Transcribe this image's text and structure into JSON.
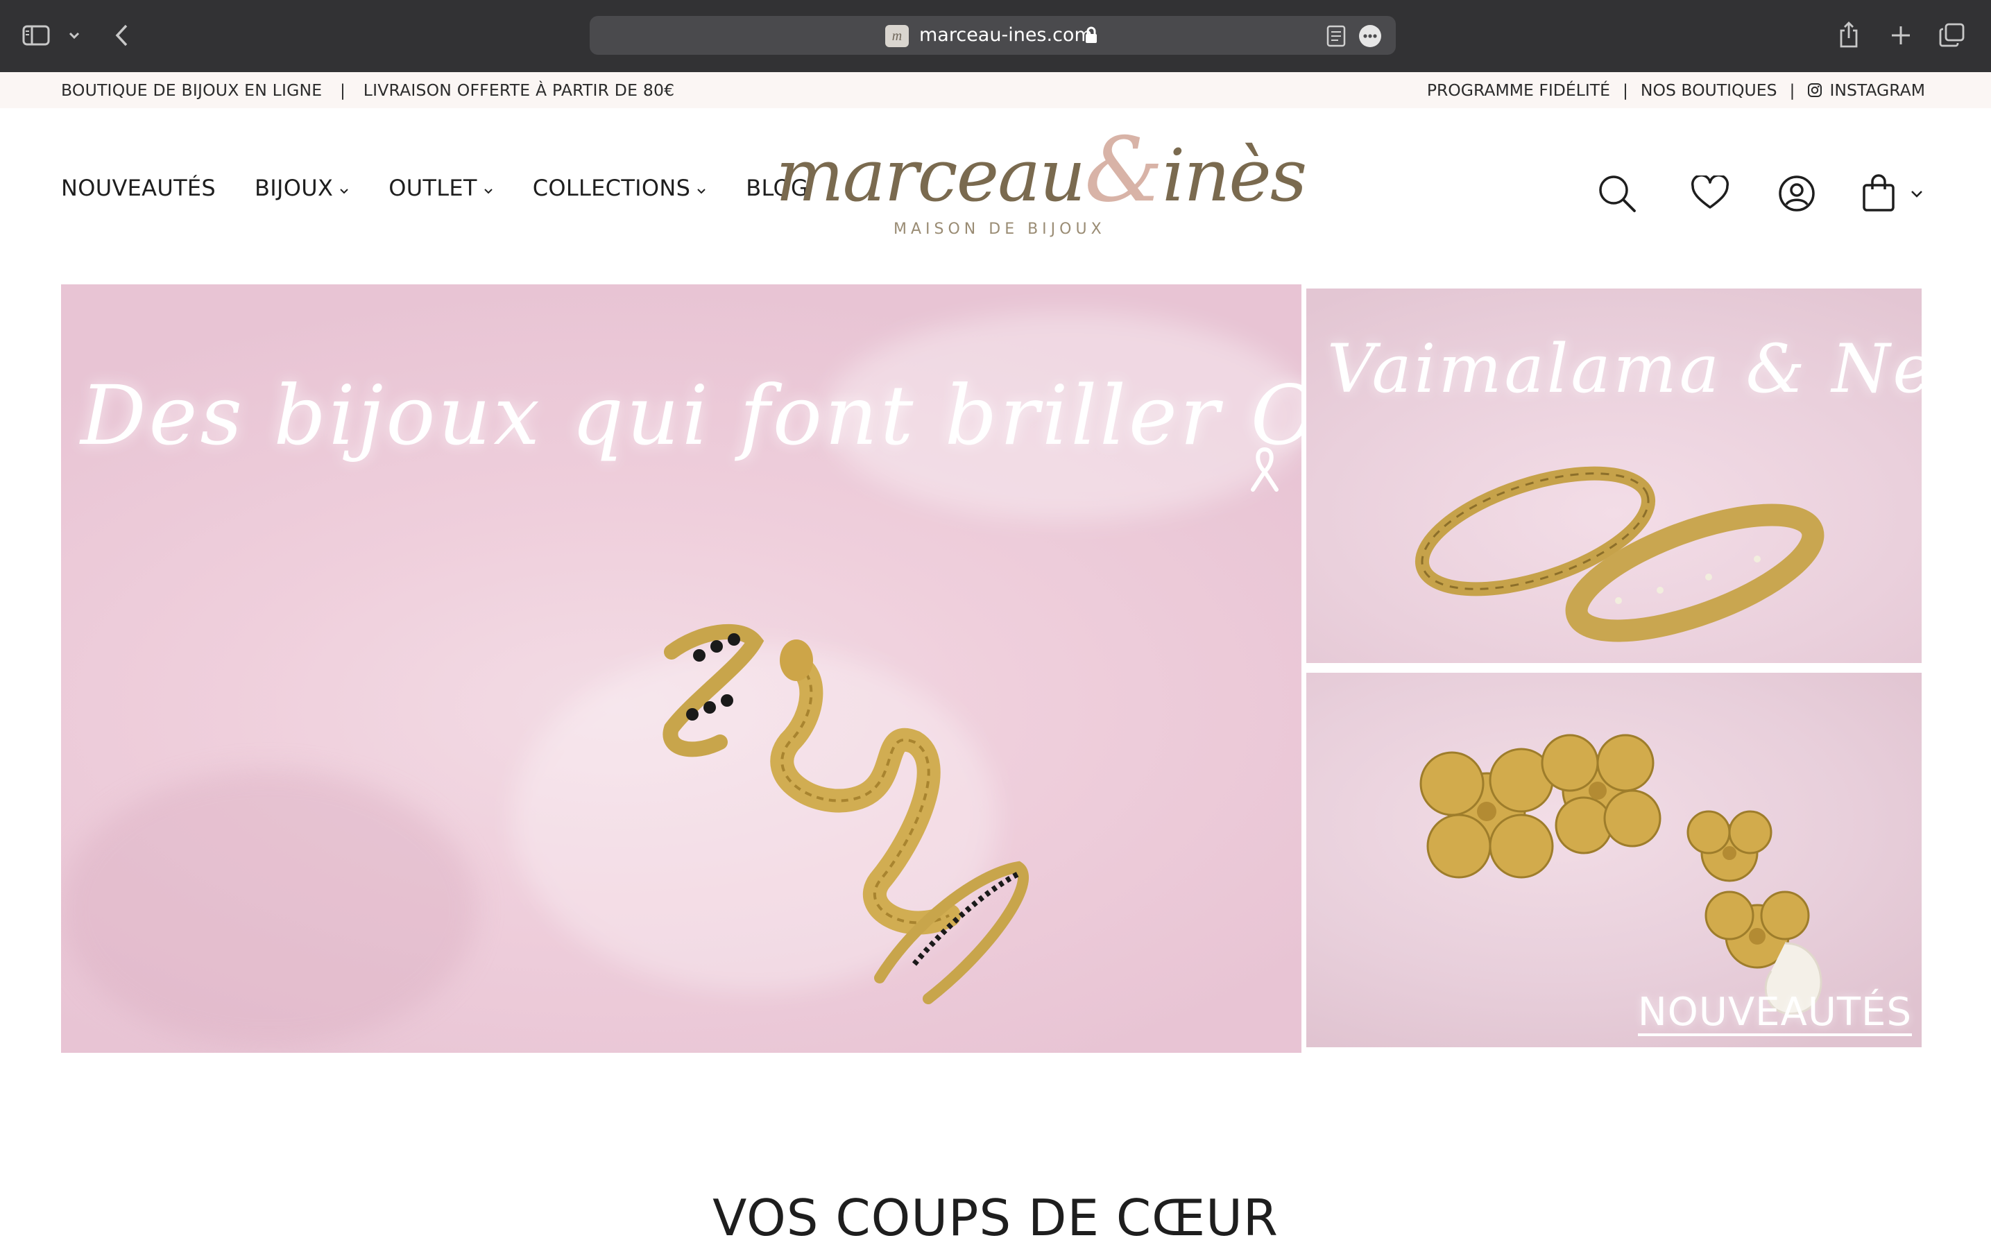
{
  "browser": {
    "url": "marceau-ines.com",
    "favicon_letter": "m"
  },
  "topbar": {
    "left_text_1": "BOUTIQUE DE BIJOUX EN LIGNE",
    "left_sep": "|",
    "left_text_2": "LIVRAISON OFFERTE À PARTIR DE 80€",
    "links": [
      "PROGRAMME FIDÉLITÉ",
      "NOS BOUTIQUES",
      "INSTAGRAM"
    ],
    "sep": "|"
  },
  "nav": {
    "items": [
      {
        "label": "NOUVEAUTÉS",
        "has_dropdown": false
      },
      {
        "label": "BIJOUX",
        "has_dropdown": true
      },
      {
        "label": "OUTLET",
        "has_dropdown": true
      },
      {
        "label": "COLLECTIONS",
        "has_dropdown": true
      },
      {
        "label": "BLOG",
        "has_dropdown": false
      }
    ]
  },
  "logo": {
    "part1": "marceau",
    "amp": "&",
    "part2": "inès",
    "tagline": "MAISON DE BIJOUX"
  },
  "header_icons": [
    "search-icon",
    "heart-icon",
    "account-icon",
    "bag-icon",
    "chevron-down-icon"
  ],
  "hero": {
    "main_title": "Des bijoux qui font briller Octobre Rose",
    "side1_title": "Vaimalama & Neyssa",
    "side2_label": "NOUVEAUTÉS"
  },
  "sections": {
    "favorites_title": "VOS COUPS DE CŒUR"
  },
  "colors": {
    "chrome_bg": "#323234",
    "topbar_bg": "#fbf6f4",
    "logo_brown": "#7a6a4f",
    "logo_pink": "#d8b3a7",
    "hero_pink": "#efcfdc"
  }
}
